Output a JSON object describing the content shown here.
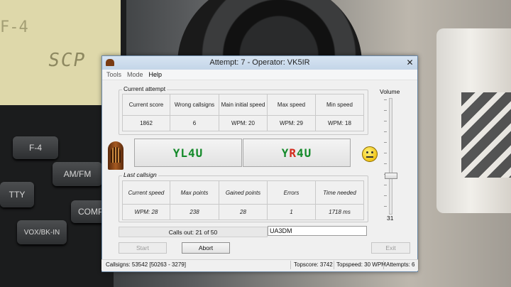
{
  "window": {
    "title": "Attempt: 7 - Operator: VK5IR",
    "close_glyph": "✕"
  },
  "menu": {
    "items": [
      {
        "label": "Tools"
      },
      {
        "label": "Mode"
      },
      {
        "label": "Help"
      }
    ]
  },
  "current_attempt": {
    "label": "Current attempt",
    "headers": [
      "Current score",
      "Wrong callsigns",
      "Main initial speed",
      "Max speed",
      "Min speed"
    ],
    "values": [
      "1862",
      "6",
      "WPM: 20",
      "WPM: 29",
      "WPM: 18"
    ]
  },
  "callsigns": {
    "left": "YL4U",
    "right_parts": [
      {
        "text": "Y",
        "color": "#148a2a"
      },
      {
        "text": "R",
        "color": "#d32b1d"
      },
      {
        "text": "4U",
        "color": "#148a2a"
      }
    ]
  },
  "last_callsign": {
    "label": "Last callsign",
    "headers": [
      "Current speed",
      "Max points",
      "Gained points",
      "Errors",
      "Time needed"
    ],
    "values": [
      "WPM: 28",
      "238",
      "28",
      "1",
      "1718 ms"
    ]
  },
  "volume": {
    "label": "Volume",
    "value": "31",
    "level_fraction": 0.31
  },
  "calls_out": "Calls out: 21 of 50",
  "call_input_value": "UA3DM",
  "buttons": {
    "start": "Start",
    "abort": "Abort",
    "exit": "Exit"
  },
  "status": {
    "callsigns": "Callsigns: 53542 [50263 - 3279]",
    "topscore": "Topscore: 3742",
    "topspeed": "Topspeed: 30 WPM",
    "attempts": "Attempts: 6"
  },
  "background": {
    "lcd_top": "F-4",
    "lcd_text": "SCP",
    "radio_buttons": [
      "F-4",
      "AM/FM",
      "TTY",
      "COMP",
      "VOX/BK-IN"
    ]
  }
}
